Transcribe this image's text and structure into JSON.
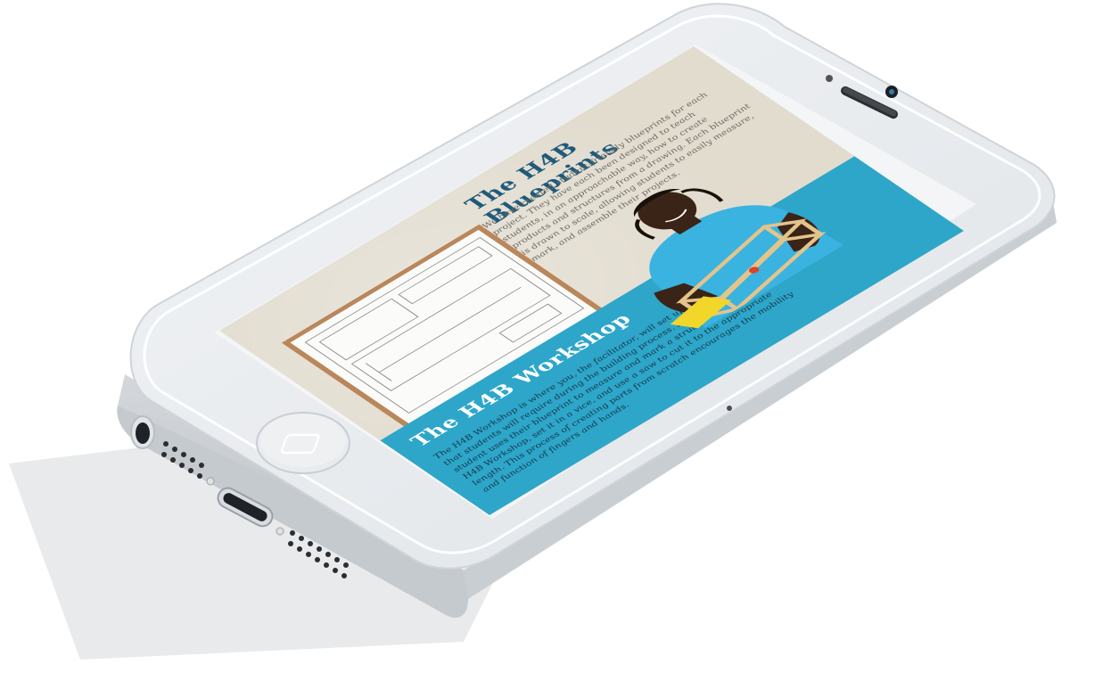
{
  "screen": {
    "blueprints": {
      "title": "The H4B Blueprints",
      "body": "We have created student-friendly blueprints for each project. They have each been designed to teach students, in an approachable way, how to create products and structures from a drawing. Each blueprint is drawn to scale, allowing students to easily measure, mark, and assemble their projects."
    },
    "workshop": {
      "title": "The H4B Workshop",
      "body": "The H4B Workshop is where you, the facilitator, will set up tools and supplies that students will require during the building process. For example, after a student uses their blueprint to measure and mark a strut, they bring it to the H4B Workshop, set it in a vice, and use a saw to cut it to the appropriate length. This process of creating parts from scratch encourages the mobility and function of fingers and hands."
    }
  },
  "colors": {
    "blueprint_bg": "#e2dccf",
    "blueprint_title": "#1f5a7a",
    "workshop_bg": "#2ea6c9",
    "phone_body": "#e6e9ec",
    "phone_edge": "#c7ccd1"
  },
  "icons": {
    "home_button": "home-square-icon",
    "camera": "camera-lens-icon",
    "speaker": "earpiece-speaker-icon"
  }
}
